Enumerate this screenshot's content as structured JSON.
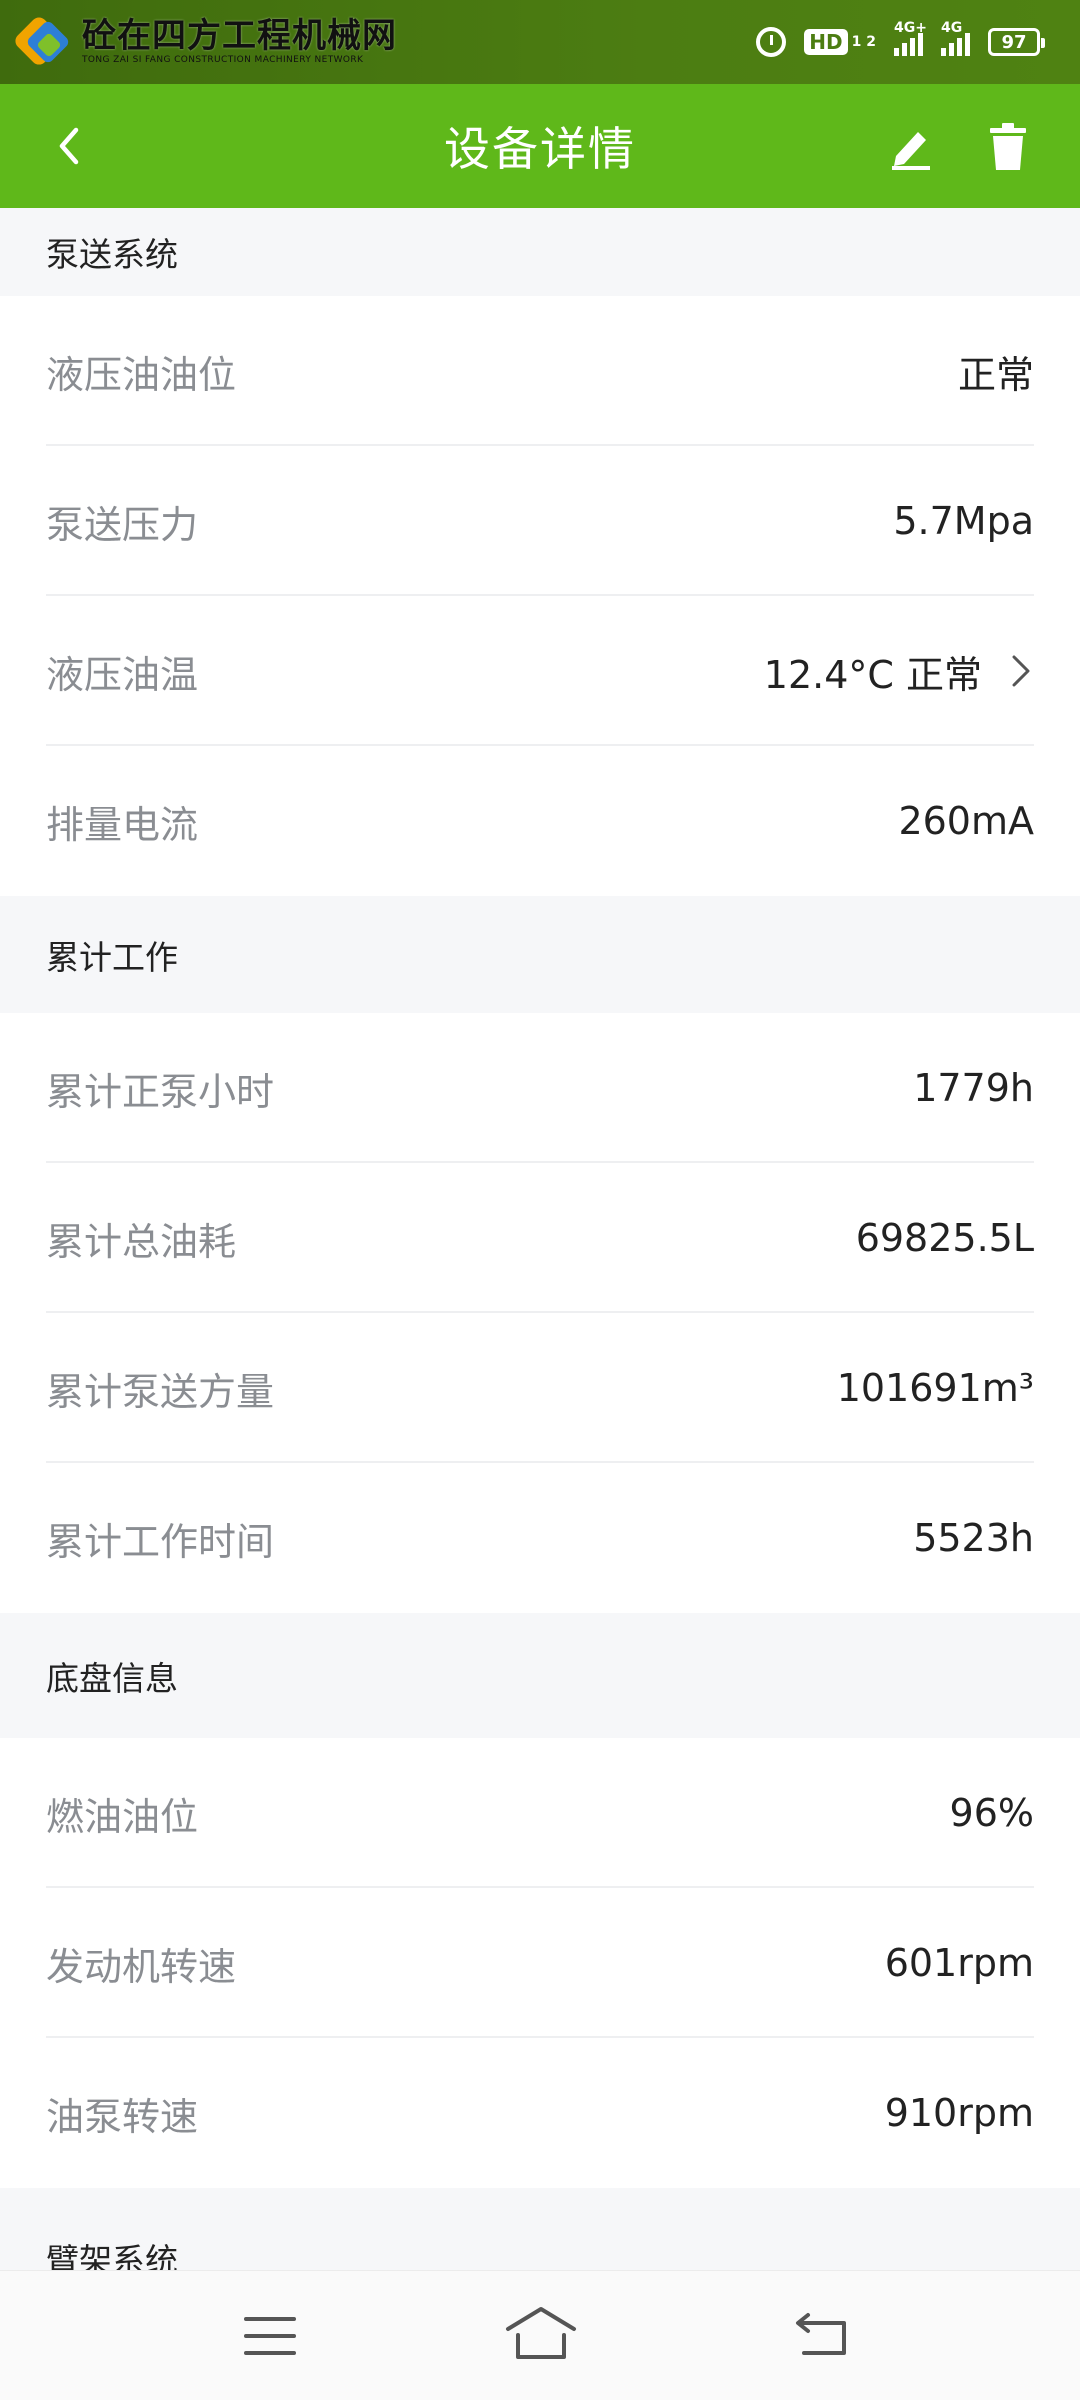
{
  "watermark": {
    "title": "砼在四方工程机械网",
    "subtitle": "TONG ZAI SI FANG CONSTRUCTION MACHINERY NETWORK"
  },
  "status_bar": {
    "hd": "HD",
    "hd_sim": "1 2",
    "signal1": "4G+",
    "signal2": "4G",
    "battery": "97"
  },
  "app_bar": {
    "title": "设备详情"
  },
  "sections": {
    "pump": {
      "title": "泵送系统",
      "rows": [
        {
          "label": "液压油油位",
          "value": "正常"
        },
        {
          "label": "泵送压力",
          "value": "5.7Mpa"
        },
        {
          "label": "液压油温",
          "value": "12.4°C 正常"
        },
        {
          "label": "排量电流",
          "value": "260mA"
        }
      ]
    },
    "cumulative": {
      "title": "累计工作",
      "rows": [
        {
          "label": "累计正泵小时",
          "value": "1779h"
        },
        {
          "label": "累计总油耗",
          "value": "69825.5L"
        },
        {
          "label": "累计泵送方量",
          "value": "101691m³"
        },
        {
          "label": "累计工作时间",
          "value": "5523h"
        }
      ]
    },
    "chassis": {
      "title": "底盘信息",
      "rows": [
        {
          "label": "燃油油位",
          "value": "96%"
        },
        {
          "label": "发动机转速",
          "value": "601rpm"
        },
        {
          "label": "油泵转速",
          "value": "910rpm"
        }
      ]
    },
    "boom": {
      "title": "臂架系统"
    }
  },
  "colors": {
    "status_bar": "#4c7d12",
    "app_bar": "#5fb81a",
    "section_bg": "#f6f7f9",
    "label": "#8a8d92",
    "value": "#222222"
  }
}
